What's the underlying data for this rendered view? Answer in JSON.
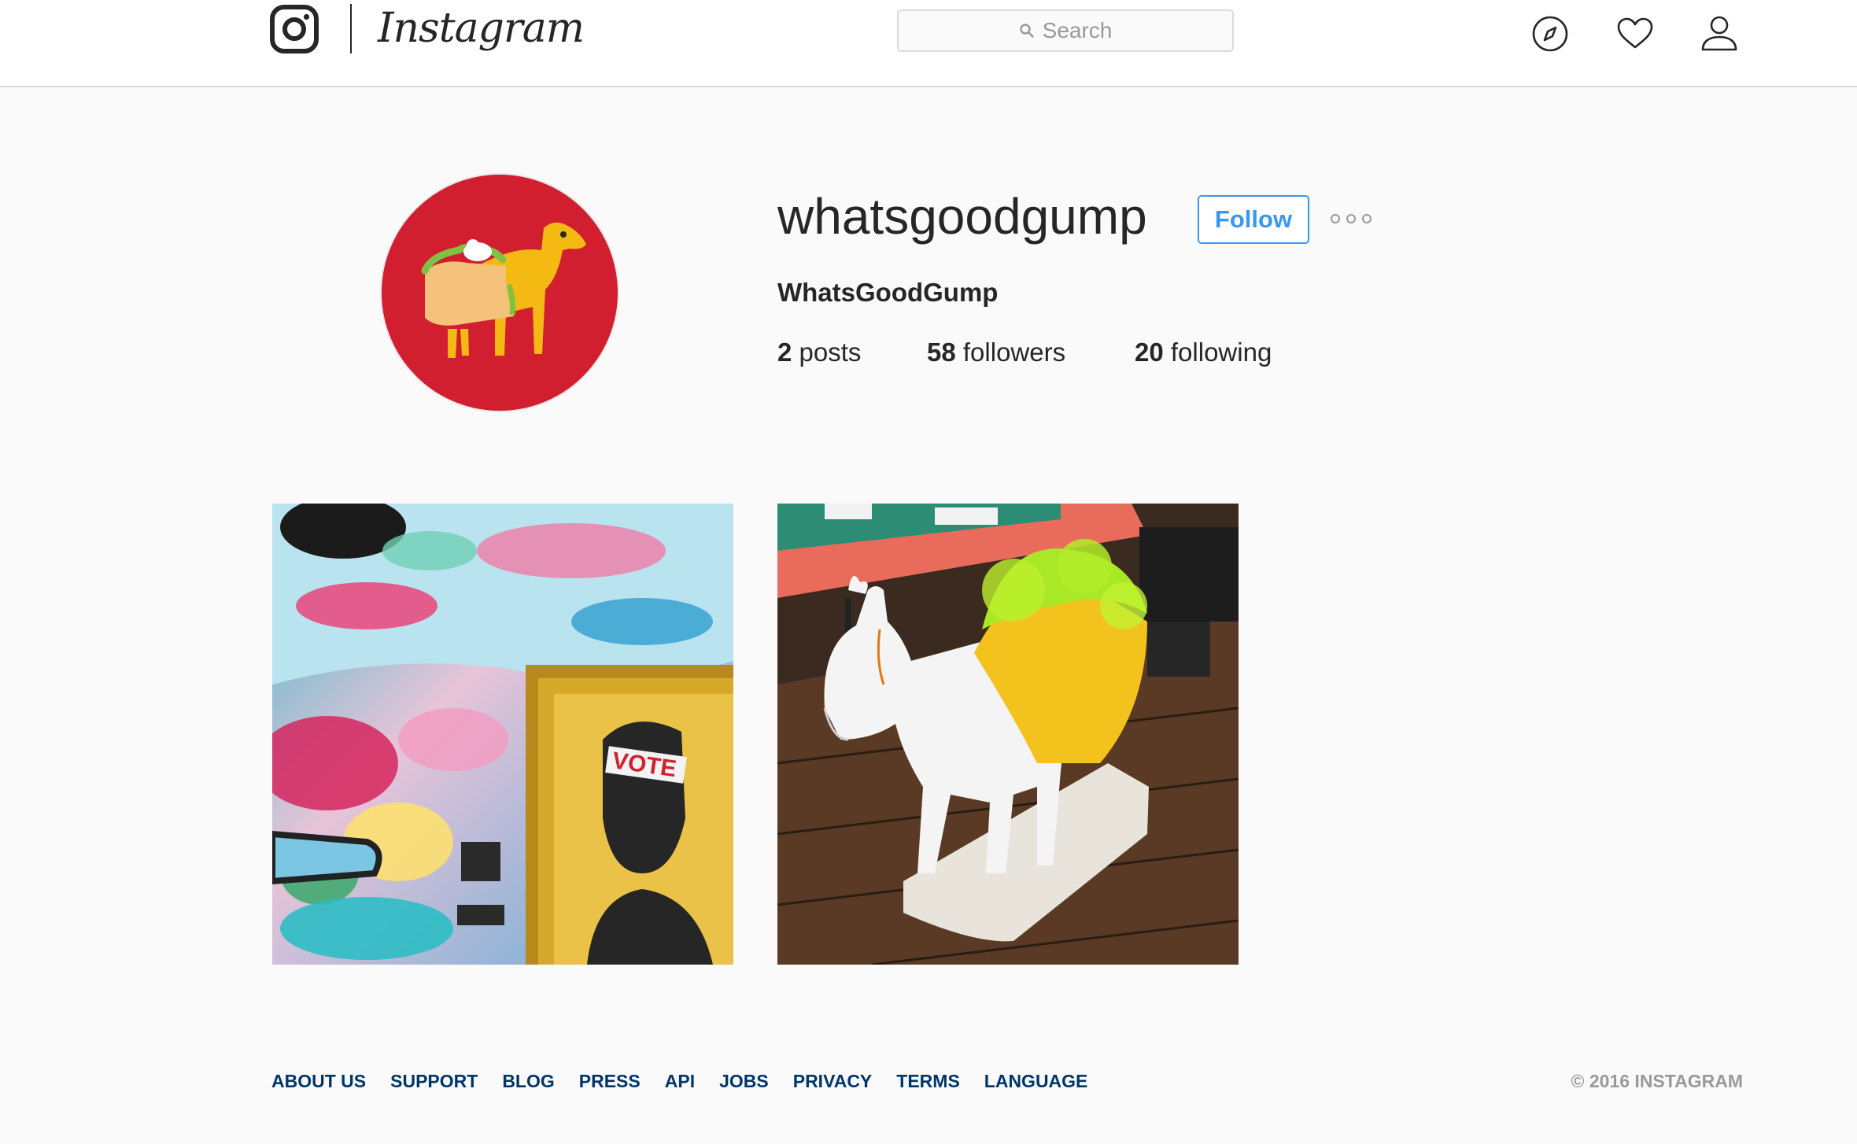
{
  "header": {
    "wordmark": "Instagram",
    "search_placeholder": "Search",
    "icons": [
      "instagram-glyph-icon",
      "search-icon",
      "compass-icon",
      "heart-icon",
      "person-icon"
    ]
  },
  "profile": {
    "username": "whatsgoodgump",
    "follow_label": "Follow",
    "full_name": "WhatsGoodGump",
    "stats": {
      "posts_count": "2",
      "posts_label": "posts",
      "followers_count": "58",
      "followers_label": "followers",
      "following_count": "20",
      "following_label": "following"
    },
    "avatar_color": "#d11f30"
  },
  "posts": [
    {
      "poster_text": "VOTE"
    },
    {
      "description_icon": "taco-llama-sculpture"
    }
  ],
  "footer": {
    "links": [
      "ABOUT US",
      "SUPPORT",
      "BLOG",
      "PRESS",
      "API",
      "JOBS",
      "PRIVACY",
      "TERMS",
      "LANGUAGE"
    ],
    "copyright": "© 2016 INSTAGRAM"
  },
  "colors": {
    "accent": "#3897f0",
    "link": "#003569",
    "muted": "#999999",
    "border": "#dbdbdb"
  }
}
